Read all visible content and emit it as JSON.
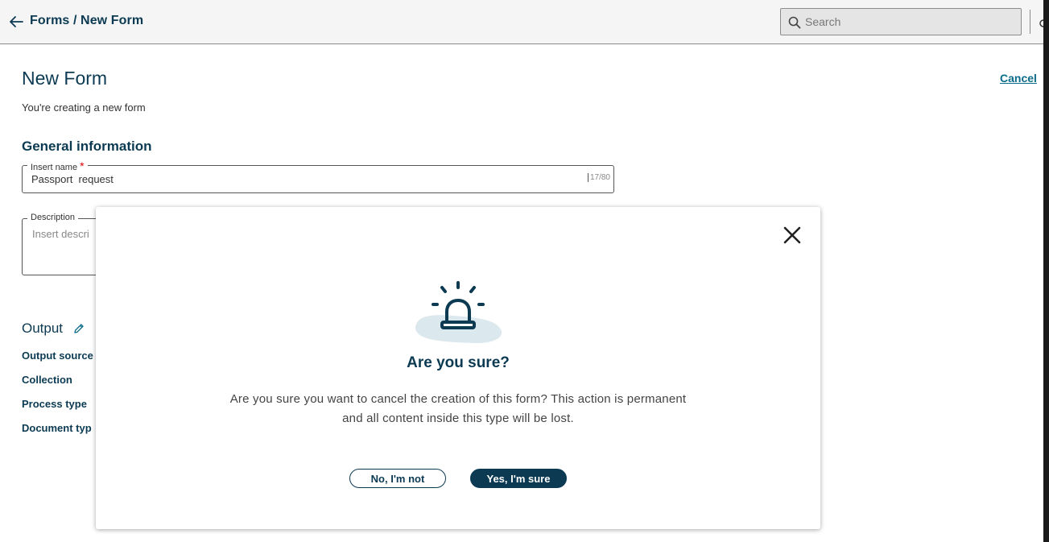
{
  "header": {
    "breadcrumb": "Forms / New Form",
    "search_placeholder": "Search"
  },
  "form": {
    "title": "New Form",
    "cancel_label": "Cancel",
    "subtitle": "You're creating a new form",
    "general_title": "General information",
    "name_label": "Insert name",
    "name_required_mark": "*",
    "name_value": "Passport  request",
    "name_counter": "17/80",
    "description_label": "Description",
    "description_placeholder": "Insert descri",
    "output_title": "Output",
    "output_labels": [
      "Output source",
      "Collection",
      "Process type",
      "Document typ"
    ]
  },
  "modal": {
    "heading": "Are you sure?",
    "body_line1": "Are you sure you want to cancel the creation of this form? This action is permanent",
    "body_line2": "and all content inside this type will be lost.",
    "no_label": "No, I'm not",
    "yes_label": "Yes, I'm sure"
  },
  "icons": {
    "back": "arrow-left-icon",
    "search": "search-icon",
    "edit": "pencil-icon",
    "close": "close-icon",
    "alarm": "siren-alarm-icon"
  },
  "colors": {
    "brand_dark": "#0b3a52",
    "link": "#0b6b8a",
    "required": "#dd0000",
    "alarm_blob": "#dbe8ee"
  }
}
